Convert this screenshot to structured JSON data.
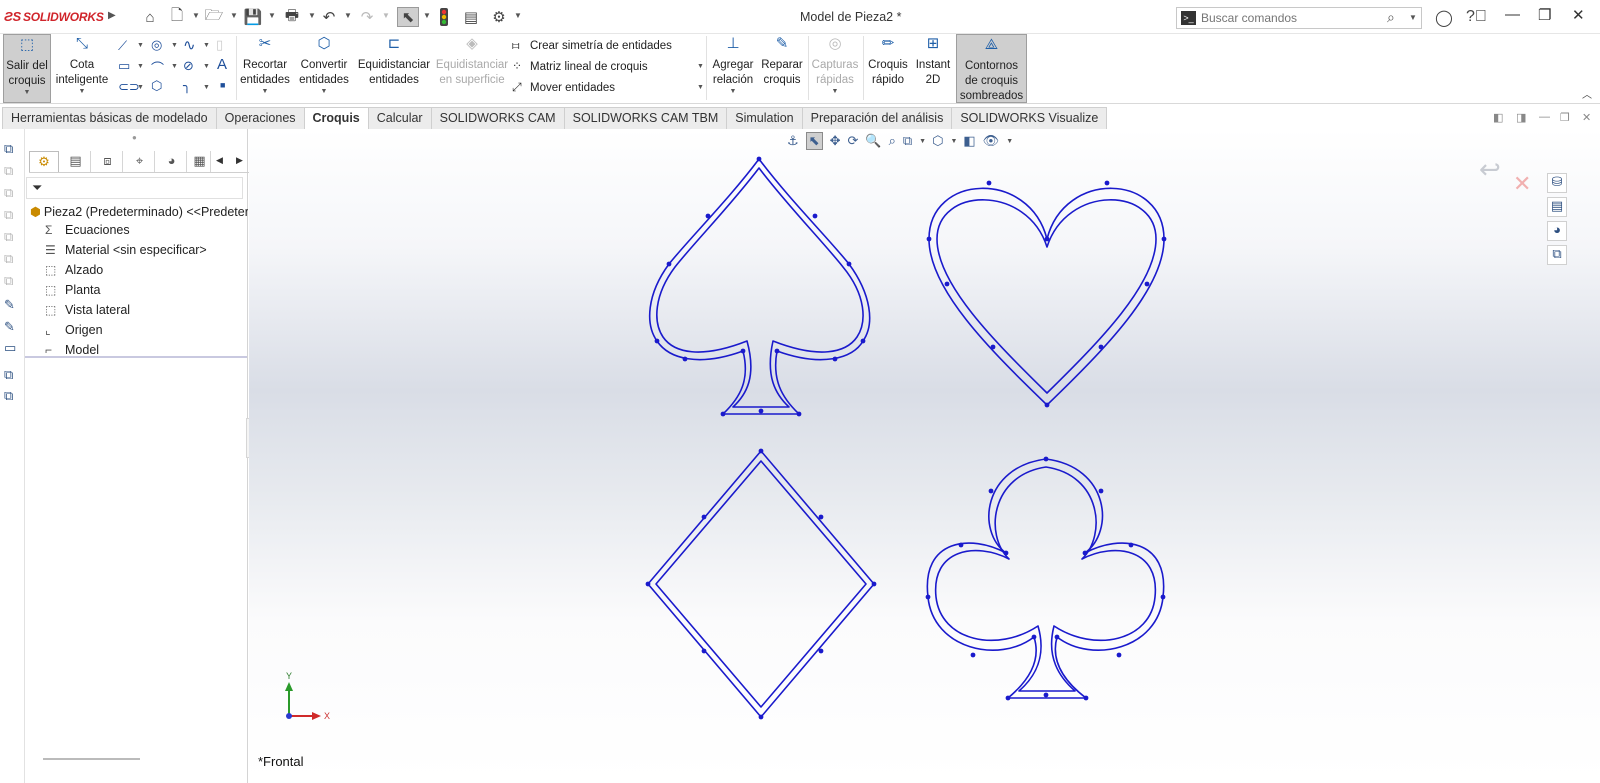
{
  "app": {
    "brand": "SOLIDWORKS",
    "document_title": "Model de Pieza2 *",
    "search_placeholder": "Buscar comandos"
  },
  "ribbon": {
    "salir": "Salir del croquis",
    "cota": "Cota inteligente",
    "recortar": "Recortar entidades",
    "convertir": "Convertir entidades",
    "equidistanciar": "Equidistanciar entidades",
    "equidistanciar_sup": "Equidistanciar en superficie",
    "simetria": "Crear simetría de entidades",
    "matriz": "Matriz lineal de croquis",
    "mover": "Mover entidades",
    "agregar": "Agregar relación",
    "reparar": "Reparar croquis",
    "capturas": "Capturas rápidas",
    "croquis_rapido": "Croquis rápido",
    "instant2d": "Instant 2D",
    "contornos": "Contornos de croquis sombreados"
  },
  "tabs": [
    "Herramientas básicas de modelado",
    "Operaciones",
    "Croquis",
    "Calcular",
    "SOLIDWORKS CAM",
    "SOLIDWORKS CAM TBM",
    "Simulation",
    "Preparación del análisis",
    "SOLIDWORKS Visualize"
  ],
  "active_tab": "Croquis",
  "tree": {
    "root": "Pieza2 (Predeterminado) <<Predeter",
    "items": [
      {
        "label": "Ecuaciones",
        "icon": "equations-icon"
      },
      {
        "label": "Material <sin especificar>",
        "icon": "material-icon"
      },
      {
        "label": "Alzado",
        "icon": "plane-icon"
      },
      {
        "label": "Planta",
        "icon": "plane-icon"
      },
      {
        "label": "Vista lateral",
        "icon": "plane-icon"
      },
      {
        "label": "Origen",
        "icon": "origin-icon"
      },
      {
        "label": "Model",
        "icon": "sketch-icon"
      }
    ]
  },
  "viewport": {
    "view_name": "*Frontal",
    "axis_x": "X",
    "axis_y": "Y",
    "sketch_color": "#1a1acc",
    "shapes": [
      "spade",
      "heart",
      "diamond",
      "club"
    ]
  },
  "colors": {
    "accent": "#1f5fa8",
    "brand_red": "#d0252b",
    "sketch": "#1a1acc"
  }
}
